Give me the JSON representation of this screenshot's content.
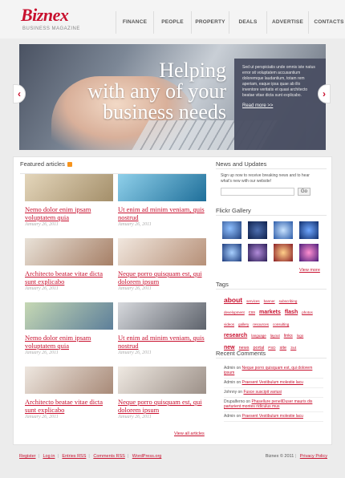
{
  "site": {
    "logo": "Biznex",
    "tagline": "BUSINESS MAGAZINE"
  },
  "nav": [
    {
      "label": "FINANCE"
    },
    {
      "label": "PEOPLE"
    },
    {
      "label": "PROPERTY"
    },
    {
      "label": "DEALS"
    },
    {
      "label": "ADVERTISE"
    },
    {
      "label": "CONTACTS"
    }
  ],
  "hero": {
    "line1": "Helping",
    "line2": "with any of your",
    "line3": "business needs",
    "text": "Sed ut perspiciatis unde omnis iste natus error sit voluptatem accusantium doloremque laudantium, totam rem aperiam, eaque ipsa quae ab illo inventore veritatis et quasi architecto beatae vitae dicta sunt explicabo.",
    "more": "Read more >>",
    "prev_icon": "chevron-left-icon",
    "next_icon": "chevron-right-icon"
  },
  "featured": {
    "title": "Featured articles",
    "rss_icon": "rss-icon",
    "articles": [
      {
        "title": "Nemo dolor enim ipsam voluptatem quia",
        "date": "January 26, 2011",
        "thumb": "#c8b48e"
      },
      {
        "title": "Ut enim ad minim veniam, quis nostrud",
        "date": "January 26, 2011",
        "thumb": "#2f8fb8"
      },
      {
        "title": "Architecto beatae vitae dicta sunt explicabo",
        "date": "January 26, 2011",
        "thumb": "#b89a84"
      },
      {
        "title": "Neque porro quisquam est, qui dolorem ipsum",
        "date": "January 26, 2011",
        "thumb": "#d7c0ad"
      },
      {
        "title": "Nemo dolor enim ipsam voluptatem quia",
        "date": "January 26, 2011",
        "thumb": "#7f9a6c"
      },
      {
        "title": "Ut enim ad minim veniam, quis nostrud",
        "date": "January 26, 2011",
        "thumb": "#8c8f96"
      },
      {
        "title": "Architecto beatae vitae dicta sunt explicabo",
        "date": "January 26, 2011",
        "thumb": "#c9b1a0"
      },
      {
        "title": "Neque porro quisquam est, qui dolorem ipsum",
        "date": "January 26, 2011",
        "thumb": "#cfc4b8"
      }
    ],
    "view_all": "View all articles"
  },
  "news": {
    "title": "News and Updates",
    "text": "Sign up now to receive breaking news and to hear what's new with our website!",
    "input_placeholder": "",
    "go": "Go"
  },
  "flickr": {
    "title": "Flickr Gallery",
    "colors": [
      "#2b4f8c",
      "#1e3d7a",
      "#5a8fd8",
      "#0f2d6b",
      "#2a4b8d",
      "#3f2d6d",
      "#d0402a",
      "#a03080"
    ],
    "view_more": "View more"
  },
  "tags": {
    "title": "Tags",
    "items": [
      {
        "label": "about",
        "size": 3
      },
      {
        "label": "services",
        "size": 0
      },
      {
        "label": "banner",
        "size": 0
      },
      {
        "label": "subscribing",
        "size": 0
      },
      {
        "label": "development",
        "size": 0
      },
      {
        "label": "css",
        "size": 1
      },
      {
        "label": "markets",
        "size": 2
      },
      {
        "label": "flash",
        "size": 2
      },
      {
        "label": "photos",
        "size": 0
      },
      {
        "label": "videos",
        "size": 0
      },
      {
        "label": "gallery",
        "size": 0
      },
      {
        "label": "resources",
        "size": 0
      },
      {
        "label": "consulting",
        "size": 0
      },
      {
        "label": "research",
        "size": 2
      },
      {
        "label": "language",
        "size": 0
      },
      {
        "label": "layout",
        "size": 0
      },
      {
        "label": "links",
        "size": 1
      },
      {
        "label": "logo",
        "size": 0
      },
      {
        "label": "new",
        "size": 2
      },
      {
        "label": "news",
        "size": 1
      },
      {
        "label": "portal",
        "size": 1
      },
      {
        "label": "PSD",
        "size": 0
      },
      {
        "label": "site",
        "size": 1
      },
      {
        "label": "3x4",
        "size": 0
      }
    ]
  },
  "comments": {
    "title": "Recent Comments",
    "items": [
      {
        "author": "Admin",
        "on": "on",
        "link": "Neque porro quisquam est, qui dolorem ipsum"
      },
      {
        "author": "Admin",
        "on": "on",
        "link": "Praesent Vestibulum molestie lacu"
      },
      {
        "author": "Johnny",
        "on": "on",
        "link": "Fusce suscipit variusi"
      },
      {
        "author": "Drupalferno",
        "on": "on",
        "link": "Phasellure penellDuser mauris dis parturient montes ridiculus mus"
      },
      {
        "author": "Admin",
        "on": "on",
        "link": "Praesent Vestibulum molestie lacu"
      }
    ]
  },
  "footer": {
    "links": [
      "Register",
      "Log in",
      "Entries RSS",
      "Comments RSS",
      "WordPress.org"
    ],
    "copyright": "Biznex © 2011",
    "privacy": "Privacy Policy"
  }
}
